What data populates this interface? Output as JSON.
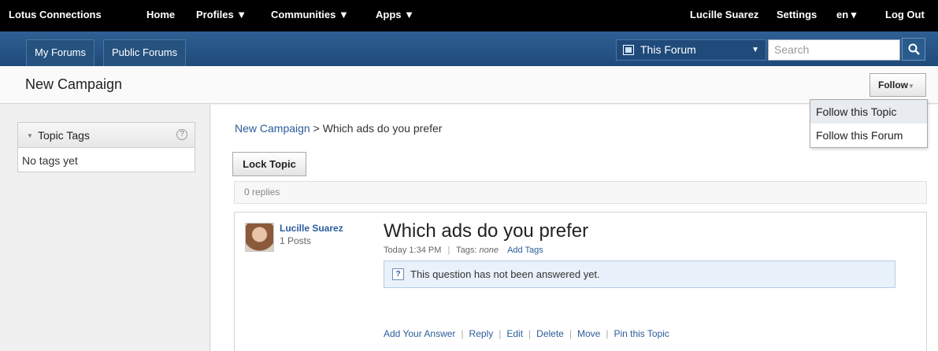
{
  "topbar": {
    "brand": "Lotus Connections",
    "home": "Home",
    "profiles": "Profiles ▼",
    "communities": "Communities ▼",
    "apps": "Apps ▼",
    "user": "Lucille Suarez",
    "settings": "Settings",
    "language": "en ▾",
    "logout": "Log Out"
  },
  "nav": {
    "tabs": [
      "My Forums",
      "Public Forums"
    ],
    "scope_label": "This Forum",
    "search_placeholder": "Search"
  },
  "page": {
    "title": "New Campaign",
    "follow_label": "Follow",
    "follow_menu": [
      "Follow this Topic",
      "Follow this Forum"
    ]
  },
  "sidebar": {
    "topic_tags_label": "Topic Tags",
    "help_glyph": "?",
    "no_tags": "No tags yet"
  },
  "breadcrumb": {
    "forum": "New Campaign",
    "separator": ">",
    "topic": "Which ads do you prefer"
  },
  "main": {
    "lock_label": "Lock Topic",
    "replies": "0 replies"
  },
  "post": {
    "author": "Lucille Suarez",
    "post_count": "1 Posts",
    "title": "Which ads do you prefer",
    "time": "Today 1:34 PM",
    "tags_label": "Tags:",
    "tags_value": "none",
    "add_tags": "Add Tags",
    "notice": "This question has not been answered yet.",
    "notice_glyph": "?",
    "actions": [
      "Add Your Answer",
      "Reply",
      "Edit",
      "Delete",
      "Move",
      "Pin this Topic"
    ]
  },
  "colors": {
    "link": "#2b5c9a",
    "nav_blue": "#1f4a7a",
    "notice_bg": "#e9f1fa"
  }
}
